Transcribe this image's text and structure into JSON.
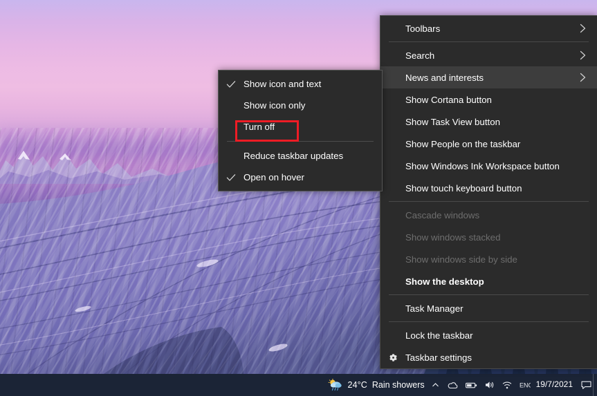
{
  "wallpaper": {
    "description": "mountain-sunset-wallpaper",
    "sky_top_color": "#c9b6ee",
    "sky_mid_color": "#efbde3",
    "cliff_color": "#8f8fc4",
    "forest_color": "#2e3f66"
  },
  "taskbar": {
    "background_color": "#1b2436",
    "weather": {
      "icon": "sun-behind-rain-cloud-icon",
      "temperature": "24°C",
      "description": "Rain showers"
    },
    "tray_icons": [
      "chevron-up-icon",
      "onedrive-icon",
      "battery-icon",
      "network-icon",
      "volume-icon",
      "language-icon"
    ],
    "clock": {
      "time": "",
      "date": "19/7/2021"
    },
    "notifications_icon": "speech-bubble-icon",
    "show_desktop_button": "show-desktop-sliver"
  },
  "context_menu": {
    "background_color": "#2b2b2b",
    "highlight_color": "#3d3d3d",
    "items": [
      {
        "id": "toolbars",
        "label": "Toolbars",
        "glyph": "",
        "arrow": true,
        "disabled": false,
        "highlighted": false,
        "bold": false,
        "separator_after": true
      },
      {
        "id": "search",
        "label": "Search",
        "glyph": "",
        "arrow": true,
        "disabled": false,
        "highlighted": false,
        "bold": false,
        "separator_after": false
      },
      {
        "id": "news-interests",
        "label": "News and interests",
        "glyph": "",
        "arrow": true,
        "disabled": false,
        "highlighted": true,
        "bold": false,
        "separator_after": false
      },
      {
        "id": "cortana",
        "label": "Show Cortana button",
        "glyph": "",
        "arrow": false,
        "disabled": false,
        "highlighted": false,
        "bold": false,
        "separator_after": false
      },
      {
        "id": "task-view",
        "label": "Show Task View button",
        "glyph": "",
        "arrow": false,
        "disabled": false,
        "highlighted": false,
        "bold": false,
        "separator_after": false
      },
      {
        "id": "people",
        "label": "Show People on the taskbar",
        "glyph": "",
        "arrow": false,
        "disabled": false,
        "highlighted": false,
        "bold": false,
        "separator_after": false
      },
      {
        "id": "windows-ink",
        "label": "Show Windows Ink Workspace button",
        "glyph": "",
        "arrow": false,
        "disabled": false,
        "highlighted": false,
        "bold": false,
        "separator_after": false
      },
      {
        "id": "touch-keyboard",
        "label": "Show touch keyboard button",
        "glyph": "",
        "arrow": false,
        "disabled": false,
        "highlighted": false,
        "bold": false,
        "separator_after": true
      },
      {
        "id": "cascade",
        "label": "Cascade windows",
        "glyph": "",
        "arrow": false,
        "disabled": true,
        "highlighted": false,
        "bold": false,
        "separator_after": false
      },
      {
        "id": "stacked",
        "label": "Show windows stacked",
        "glyph": "",
        "arrow": false,
        "disabled": true,
        "highlighted": false,
        "bold": false,
        "separator_after": false
      },
      {
        "id": "side-by-side",
        "label": "Show windows side by side",
        "glyph": "",
        "arrow": false,
        "disabled": true,
        "highlighted": false,
        "bold": false,
        "separator_after": false
      },
      {
        "id": "show-desktop",
        "label": "Show the desktop",
        "glyph": "",
        "arrow": false,
        "disabled": false,
        "highlighted": false,
        "bold": true,
        "separator_after": true
      },
      {
        "id": "task-manager",
        "label": "Task Manager",
        "glyph": "",
        "arrow": false,
        "disabled": false,
        "highlighted": false,
        "bold": false,
        "separator_after": true
      },
      {
        "id": "lock-taskbar",
        "label": "Lock the taskbar",
        "glyph": "",
        "arrow": false,
        "disabled": false,
        "highlighted": false,
        "bold": false,
        "separator_after": false
      },
      {
        "id": "taskbar-settings",
        "label": "Taskbar settings",
        "glyph": "gear-icon",
        "arrow": false,
        "disabled": false,
        "highlighted": false,
        "bold": false,
        "separator_after": false
      }
    ]
  },
  "submenu": {
    "parent": "News and interests",
    "background_color": "#2b2b2b",
    "items": [
      {
        "id": "show-icon-and-text",
        "label": "Show icon and text",
        "checked": true,
        "separator_after": false
      },
      {
        "id": "show-icon-only",
        "label": "Show icon only",
        "checked": false,
        "separator_after": false
      },
      {
        "id": "turn-off",
        "label": "Turn off",
        "checked": false,
        "separator_after": true
      },
      {
        "id": "reduce-taskbar-updates",
        "label": "Reduce taskbar updates",
        "checked": false,
        "separator_after": false
      },
      {
        "id": "open-on-hover",
        "label": "Open on hover",
        "checked": true,
        "separator_after": false
      }
    ]
  },
  "annotation": {
    "target": "Turn off",
    "color": "#ee1c25",
    "style": "rectangle-outline"
  }
}
